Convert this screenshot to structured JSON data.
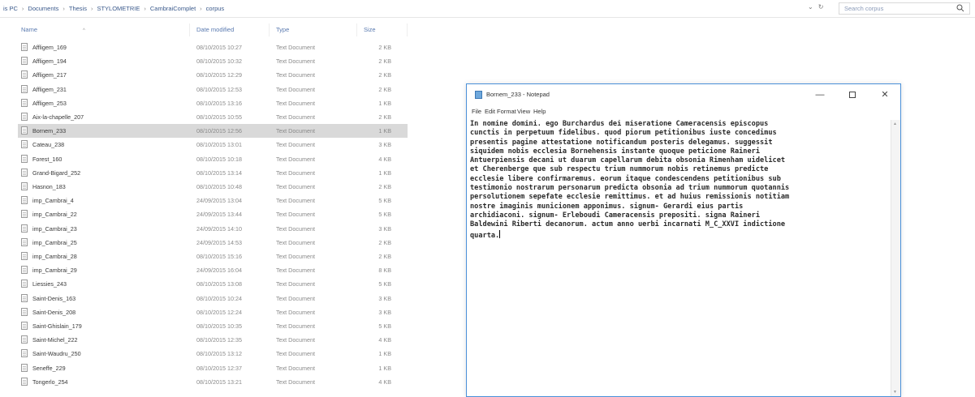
{
  "breadcrumb": [
    "is PC",
    "Documents",
    "Thesis",
    "STYLOMETRIE",
    "CambraiComplet",
    "corpus"
  ],
  "breadcrumb_separator": "›",
  "search": {
    "placeholder": "Search corpus"
  },
  "columns": {
    "name": "Name",
    "date": "Date modified",
    "type": "Type",
    "size": "Size"
  },
  "files": [
    {
      "name": "Affligem_169",
      "date": "08/10/2015 10:27",
      "type": "Text Document",
      "size": "2 KB"
    },
    {
      "name": "Affligem_194",
      "date": "08/10/2015 10:32",
      "type": "Text Document",
      "size": "2 KB"
    },
    {
      "name": "Affligem_217",
      "date": "08/10/2015 12:29",
      "type": "Text Document",
      "size": "2 KB"
    },
    {
      "name": "Affligem_231",
      "date": "08/10/2015 12:53",
      "type": "Text Document",
      "size": "2 KB"
    },
    {
      "name": "Affligem_253",
      "date": "08/10/2015 13:16",
      "type": "Text Document",
      "size": "1 KB"
    },
    {
      "name": "Aix-la-chapelle_207",
      "date": "08/10/2015 10:55",
      "type": "Text Document",
      "size": "2 KB"
    },
    {
      "name": "Bornem_233",
      "date": "08/10/2015 12:56",
      "type": "Text Document",
      "size": "1 KB",
      "selected": true
    },
    {
      "name": "Cateau_238",
      "date": "08/10/2015 13:01",
      "type": "Text Document",
      "size": "3 KB"
    },
    {
      "name": "Forest_160",
      "date": "08/10/2015 10:18",
      "type": "Text Document",
      "size": "4 KB"
    },
    {
      "name": "Grand-Bigard_252",
      "date": "08/10/2015 13:14",
      "type": "Text Document",
      "size": "1 KB"
    },
    {
      "name": "Hasnon_183",
      "date": "08/10/2015 10:48",
      "type": "Text Document",
      "size": "2 KB"
    },
    {
      "name": "imp_Cambrai_4",
      "date": "24/09/2015 13:04",
      "type": "Text Document",
      "size": "5 KB"
    },
    {
      "name": "imp_Cambrai_22",
      "date": "24/09/2015 13:44",
      "type": "Text Document",
      "size": "5 KB"
    },
    {
      "name": "imp_Cambrai_23",
      "date": "24/09/2015 14:10",
      "type": "Text Document",
      "size": "3 KB"
    },
    {
      "name": "imp_Cambrai_25",
      "date": "24/09/2015 14:53",
      "type": "Text Document",
      "size": "2 KB"
    },
    {
      "name": "imp_Cambrai_28",
      "date": "08/10/2015 15:16",
      "type": "Text Document",
      "size": "2 KB"
    },
    {
      "name": "imp_Cambrai_29",
      "date": "24/09/2015 16:04",
      "type": "Text Document",
      "size": "8 KB"
    },
    {
      "name": "Liessies_243",
      "date": "08/10/2015 13:08",
      "type": "Text Document",
      "size": "5 KB"
    },
    {
      "name": "Saint-Denis_163",
      "date": "08/10/2015 10:24",
      "type": "Text Document",
      "size": "3 KB"
    },
    {
      "name": "Saint-Denis_208",
      "date": "08/10/2015 12:24",
      "type": "Text Document",
      "size": "3 KB"
    },
    {
      "name": "Saint-Ghislain_179",
      "date": "08/10/2015 10:35",
      "type": "Text Document",
      "size": "5 KB"
    },
    {
      "name": "Saint-Michel_222",
      "date": "08/10/2015 12:35",
      "type": "Text Document",
      "size": "4 KB"
    },
    {
      "name": "Saint-Waudru_250",
      "date": "08/10/2015 13:12",
      "type": "Text Document",
      "size": "1 KB"
    },
    {
      "name": "Seneffe_229",
      "date": "08/10/2015 12:37",
      "type": "Text Document",
      "size": "1 KB"
    },
    {
      "name": "Tongerlo_254",
      "date": "08/10/2015 13:21",
      "type": "Text Document",
      "size": "4 KB"
    }
  ],
  "notepad": {
    "title": "Bornem_233 - Notepad",
    "menus": [
      "File",
      "Edit",
      "Format",
      "View",
      "Help"
    ],
    "lines": [
      "In nomine domini. ego Burchardus dei miseratione Cameracensis episcopus",
      "cunctis in perpetuum fidelibus. quod piorum petitionibus iuste concedimus",
      "presentis pagine attestatione notificandum posteris delegamus. suggessit",
      "siquidem nobis ecclesia Bornehensis instante quoque peticione Raineri",
      "Antuerpiensis decani ut duarum capellarum debita obsonia Rimenham uidelicet",
      "et Cherenberge que sub respectu trium nummorum nobis retinemus predicte",
      "ecclesie libere confirmaremus. eorum itaque condescendens petitionibus sub",
      "testimonio nostrarum personarum predicta obsonia ad trium nummorum quotannis",
      "persolutionem sepefate ecclesie remittimus. et ad huius remissionis notitiam",
      "nostre imaginis municionem apponimus. signum- Gerardi eius partis",
      "archidiaconi. signum- Erleboudi Cameracensis prepositi. signa Raineri",
      "Baldewini Riberti decanorum. actum anno uerbi incarnati M_C_XXVI indictione",
      "quarta."
    ]
  },
  "colors": {
    "accent": "#4a90d9",
    "selection": "#d9d9d9",
    "link_text": "#3b5a8c"
  }
}
